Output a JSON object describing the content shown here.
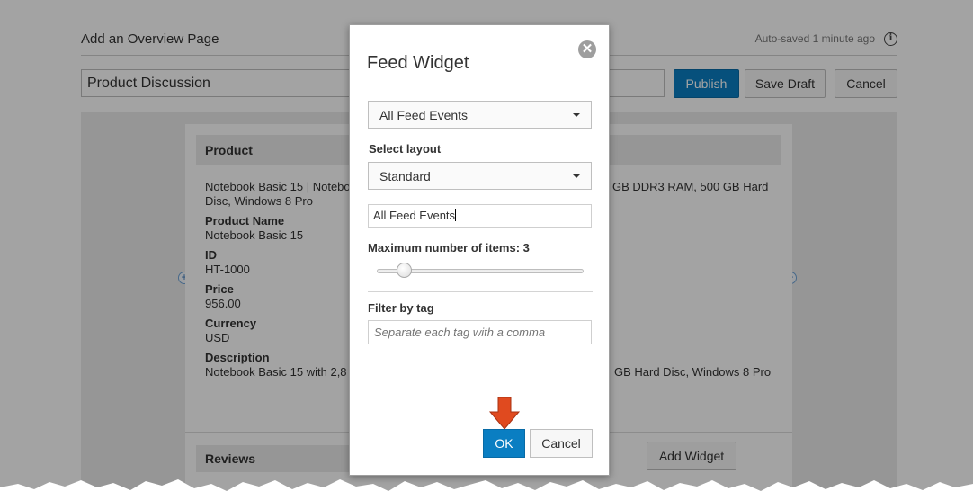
{
  "editor": {
    "page_title": "Add an Overview Page",
    "autosave": "Auto-saved 1 minute ago",
    "title_value": "Product Discussion",
    "publish_label": "Publish",
    "save_draft_label": "Save Draft",
    "cancel_label": "Cancel",
    "add_widget_label": "Add Widget"
  },
  "card": {
    "header": "Product",
    "summary_line1": "Notebook Basic 15 | Notebo",
    "summary_line1_right": "GB DDR3 RAM, 500 GB Hard",
    "summary_line2": "Disc, Windows 8 Pro",
    "fields": [
      {
        "label": "Product Name",
        "value": "Notebook Basic 15"
      },
      {
        "label": "ID",
        "value": "HT-1000"
      },
      {
        "label": "Price",
        "value": "956.00"
      },
      {
        "label": "Currency",
        "value": "USD"
      },
      {
        "label": "Description",
        "value": "Notebook Basic 15 with 2,8"
      }
    ],
    "description_right": "GB Hard Disc, Windows 8 Pro",
    "reviews_header": "Reviews"
  },
  "dialog": {
    "title": "Feed Widget",
    "feed_select_value": "All Feed Events",
    "layout_label": "Select layout",
    "layout_select_value": "Standard",
    "title_input_value": "All Feed Events",
    "max_items_label": "Maximum number of items:",
    "max_items_value": "3",
    "max_items_slider": {
      "min": 1,
      "max": 20,
      "value": 3
    },
    "filter_label": "Filter by tag",
    "filter_placeholder": "Separate each tag with a comma",
    "ok_label": "OK",
    "cancel_label": "Cancel"
  },
  "colors": {
    "primary": "#0a7ec2",
    "overlay": "rgba(0,0,0,0.36)",
    "arrow": "#e04a1f"
  }
}
